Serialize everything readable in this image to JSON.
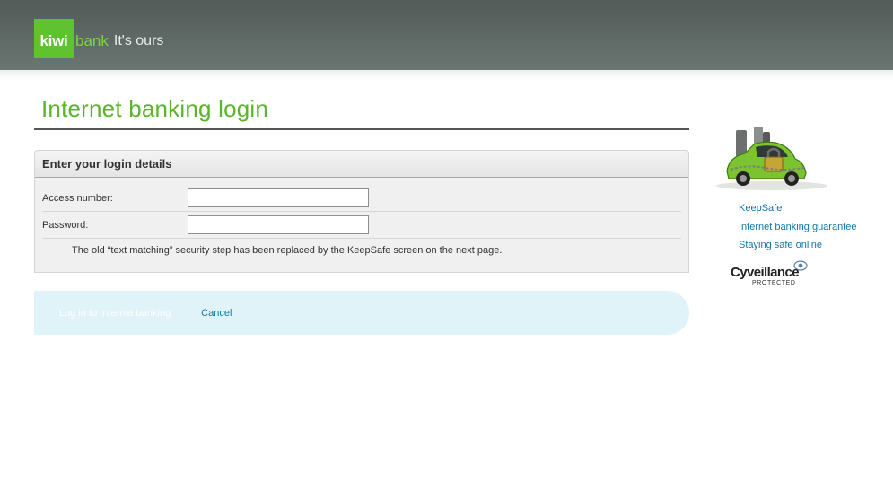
{
  "brand": {
    "logo_word": "kiwi",
    "logo_bank": "bank",
    "tagline": "It's ours",
    "green": "#5ec32e",
    "header_color": "#5b6562"
  },
  "page": {
    "title": "Internet banking login"
  },
  "login_panel": {
    "heading": "Enter your login details",
    "access_label": "Access number:",
    "access_value": "",
    "password_label": "Password:",
    "password_value": "",
    "note": "The old “text matching” security step has been replaced by the KeepSafe screen on the next page."
  },
  "actions": {
    "login_label": "Log in to Internet banking",
    "cancel_label": "Cancel"
  },
  "sidebar": {
    "image_icon": "locked-car-icon",
    "links": [
      {
        "label": "KeepSafe"
      },
      {
        "label": "Internet banking guarantee"
      },
      {
        "label": "Staying safe online"
      }
    ],
    "badge": {
      "name": "Cyveillance",
      "sub": "PROTECTED"
    }
  }
}
